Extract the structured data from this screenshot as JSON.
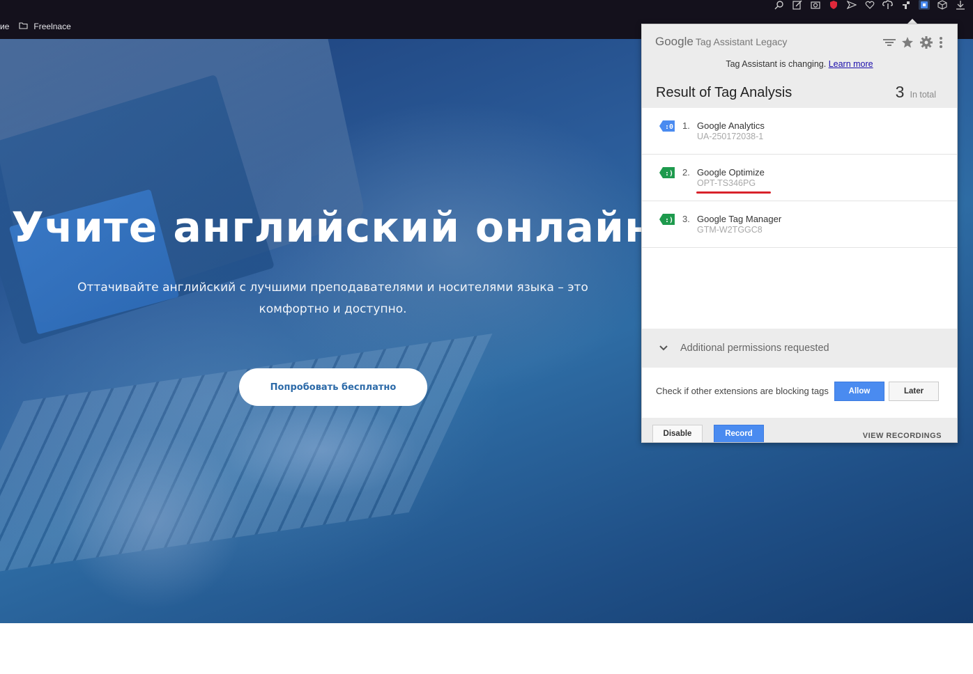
{
  "browser": {
    "bookmark_fragment": "ие",
    "bookmark_folder": "Freelnace",
    "toolbar_icons": [
      "search-icon",
      "edit-icon",
      "camera-icon",
      "shield-icon",
      "send-icon",
      "heart-icon",
      "cloud-download-icon",
      "extension-icon",
      "tag-assistant-icon",
      "cube-icon",
      "download-icon"
    ]
  },
  "hero": {
    "title": "Учите английский онлайн",
    "subtitle": "Оттачивайте английский с лучшими преподавателями и носителями языка – это комфортно и доступно.",
    "cta": "Попробовать бесплатно"
  },
  "popup": {
    "brand_google": "Google",
    "brand_name": "Tag Assistant Legacy",
    "notice_text": "Tag Assistant is changing.",
    "notice_link": "Learn more",
    "result_title": "Result of Tag Analysis",
    "result_count": "3",
    "result_count_label": "In total",
    "tags": [
      {
        "num": "1.",
        "name": "Google Analytics",
        "id": "UA-250172038-1",
        "color": "#4a8bf0"
      },
      {
        "num": "2.",
        "name": "Google Optimize",
        "id": "OPT-TS346PG",
        "color": "#1e9a4d"
      },
      {
        "num": "3.",
        "name": "Google Tag Manager",
        "id": "GTM-W2TGGC8",
        "color": "#1e9a4d"
      }
    ],
    "permissions_label": "Additional permissions requested",
    "check_text": "Check if other extensions are blocking tags",
    "allow_label": "Allow",
    "later_label": "Later",
    "disable_label": "Disable",
    "record_label": "Record",
    "view_recordings_label": "VIEW RECORDINGS",
    "highlight_color": "#d8222a"
  }
}
